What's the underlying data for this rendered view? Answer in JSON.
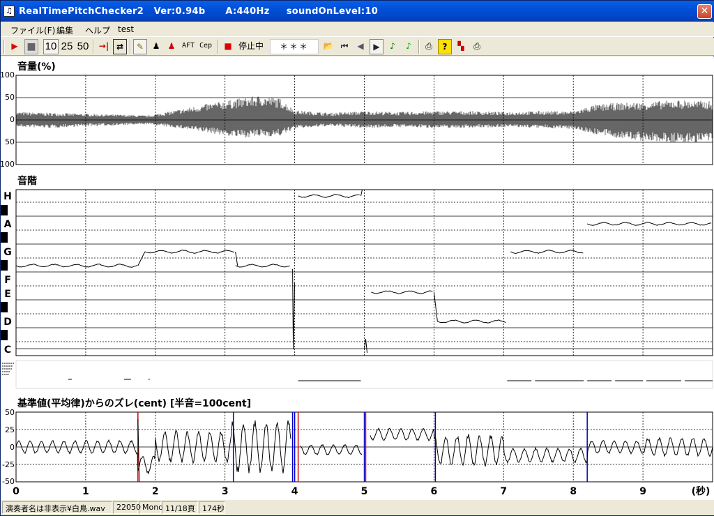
{
  "window": {
    "title": "RealTimePitchChecker2   Ver:0.94b      A:440Hz     soundOnLevel:10",
    "close_glyph": "✕",
    "icon_glyph": "♫"
  },
  "menu": [
    "ファイル(F)",
    "編集",
    "ヘルプ",
    "test"
  ],
  "toolbar": {
    "play_icon": "▶",
    "stop_icon": "■",
    "num_10": "10",
    "num_25": "25",
    "num_50": "50",
    "jump_icon": "→|",
    "loop_icon": "⇄",
    "brush_icon": "✎",
    "person_icon": "♟",
    "person2_icon": "♟",
    "aft_label": "AFT",
    "cep_label": "Cep",
    "rec_icon": "■",
    "status_label": "停止中",
    "pitch_display": "＊＊＊",
    "open_icon": "📂",
    "first_icon": "⏮",
    "prev_icon": "◀",
    "next_icon": "▶",
    "note1_icon": "♪",
    "note2_icon": "♪",
    "print_icon": "⎙",
    "help_icon": "?",
    "grid_icon": "▚",
    "print2_icon": "⎙"
  },
  "colors": {
    "background": "#ECE9D8",
    "plot_bg": "#FFFFFF",
    "trace": "#000000",
    "marker_blue": "#0000CC",
    "marker_red": "#CC0000",
    "titlebar": "#0050D8"
  },
  "chart_data": [
    {
      "type": "area",
      "title": "音量(%)",
      "ylabel_ticks": [
        "100",
        "50",
        "0",
        "50",
        "100"
      ],
      "ylim": [
        -100,
        100
      ],
      "xlim": [
        0,
        10
      ],
      "grid": true,
      "envelope": {
        "x": [
          0,
          0.5,
          1,
          1.5,
          1.9,
          2.3,
          2.8,
          3.2,
          3.5,
          3.8,
          4.0,
          4.5,
          5.0,
          5.5,
          6.0,
          6.5,
          7.0,
          7.5,
          8.0,
          8.3,
          8.6,
          9.0,
          9.5,
          10.0
        ],
        "upper": [
          18,
          16,
          14,
          12,
          10,
          22,
          38,
          48,
          55,
          48,
          22,
          16,
          20,
          18,
          20,
          20,
          18,
          20,
          20,
          34,
          38,
          40,
          45,
          42
        ],
        "lower": [
          -16,
          -18,
          -14,
          -12,
          -10,
          -18,
          -30,
          -40,
          -38,
          -36,
          -20,
          -14,
          -18,
          -16,
          -18,
          -18,
          -16,
          -18,
          -20,
          -32,
          -40,
          -48,
          -52,
          -50
        ]
      }
    },
    {
      "type": "line",
      "title": "音階",
      "note_labels": [
        "H",
        "A",
        "G",
        "F",
        "E",
        "D",
        "C"
      ],
      "xlim": [
        0,
        10
      ],
      "grid": true,
      "segments": [
        {
          "x": [
            0,
            1.0,
            1.75
          ],
          "level": "F#"
        },
        {
          "x": [
            1.85,
            3.15
          ],
          "level": "G"
        },
        {
          "x": [
            3.15,
            3.95
          ],
          "level": "F#"
        },
        {
          "x": [
            4.05,
            4.95
          ],
          "level": "H"
        },
        {
          "x": [
            5.1,
            6.0
          ],
          "level": "E"
        },
        {
          "x": [
            6.05,
            7.05
          ],
          "level": "D"
        },
        {
          "x": [
            7.1,
            8.15
          ],
          "level": "G"
        },
        {
          "x": [
            8.2,
            10.0
          ],
          "level": "A"
        }
      ]
    },
    {
      "type": "line",
      "title": "基準値(平均律)からのズレ(cent) [半音=100cent]",
      "y_ticks": [
        "50",
        "25",
        "0",
        "-25",
        "-50"
      ],
      "ylim": [
        -50,
        50
      ],
      "xlim": [
        0,
        10
      ],
      "x_ticks": [
        "0",
        "1",
        "2",
        "3",
        "4",
        "5",
        "6",
        "7",
        "8",
        "9"
      ],
      "x_unit": "(秒)",
      "grid": true,
      "blue_markers": [
        3.12,
        3.97,
        4.0,
        5.0,
        6.02,
        8.2
      ],
      "red_markers": [
        1.75,
        4.05,
        5.02
      ]
    }
  ],
  "statusbar": {
    "file": "演奏者名は非表示¥白鳥.wav",
    "rate": "22050",
    "channels": "Mono",
    "page": "11/18頁",
    "duration": "174秒"
  }
}
